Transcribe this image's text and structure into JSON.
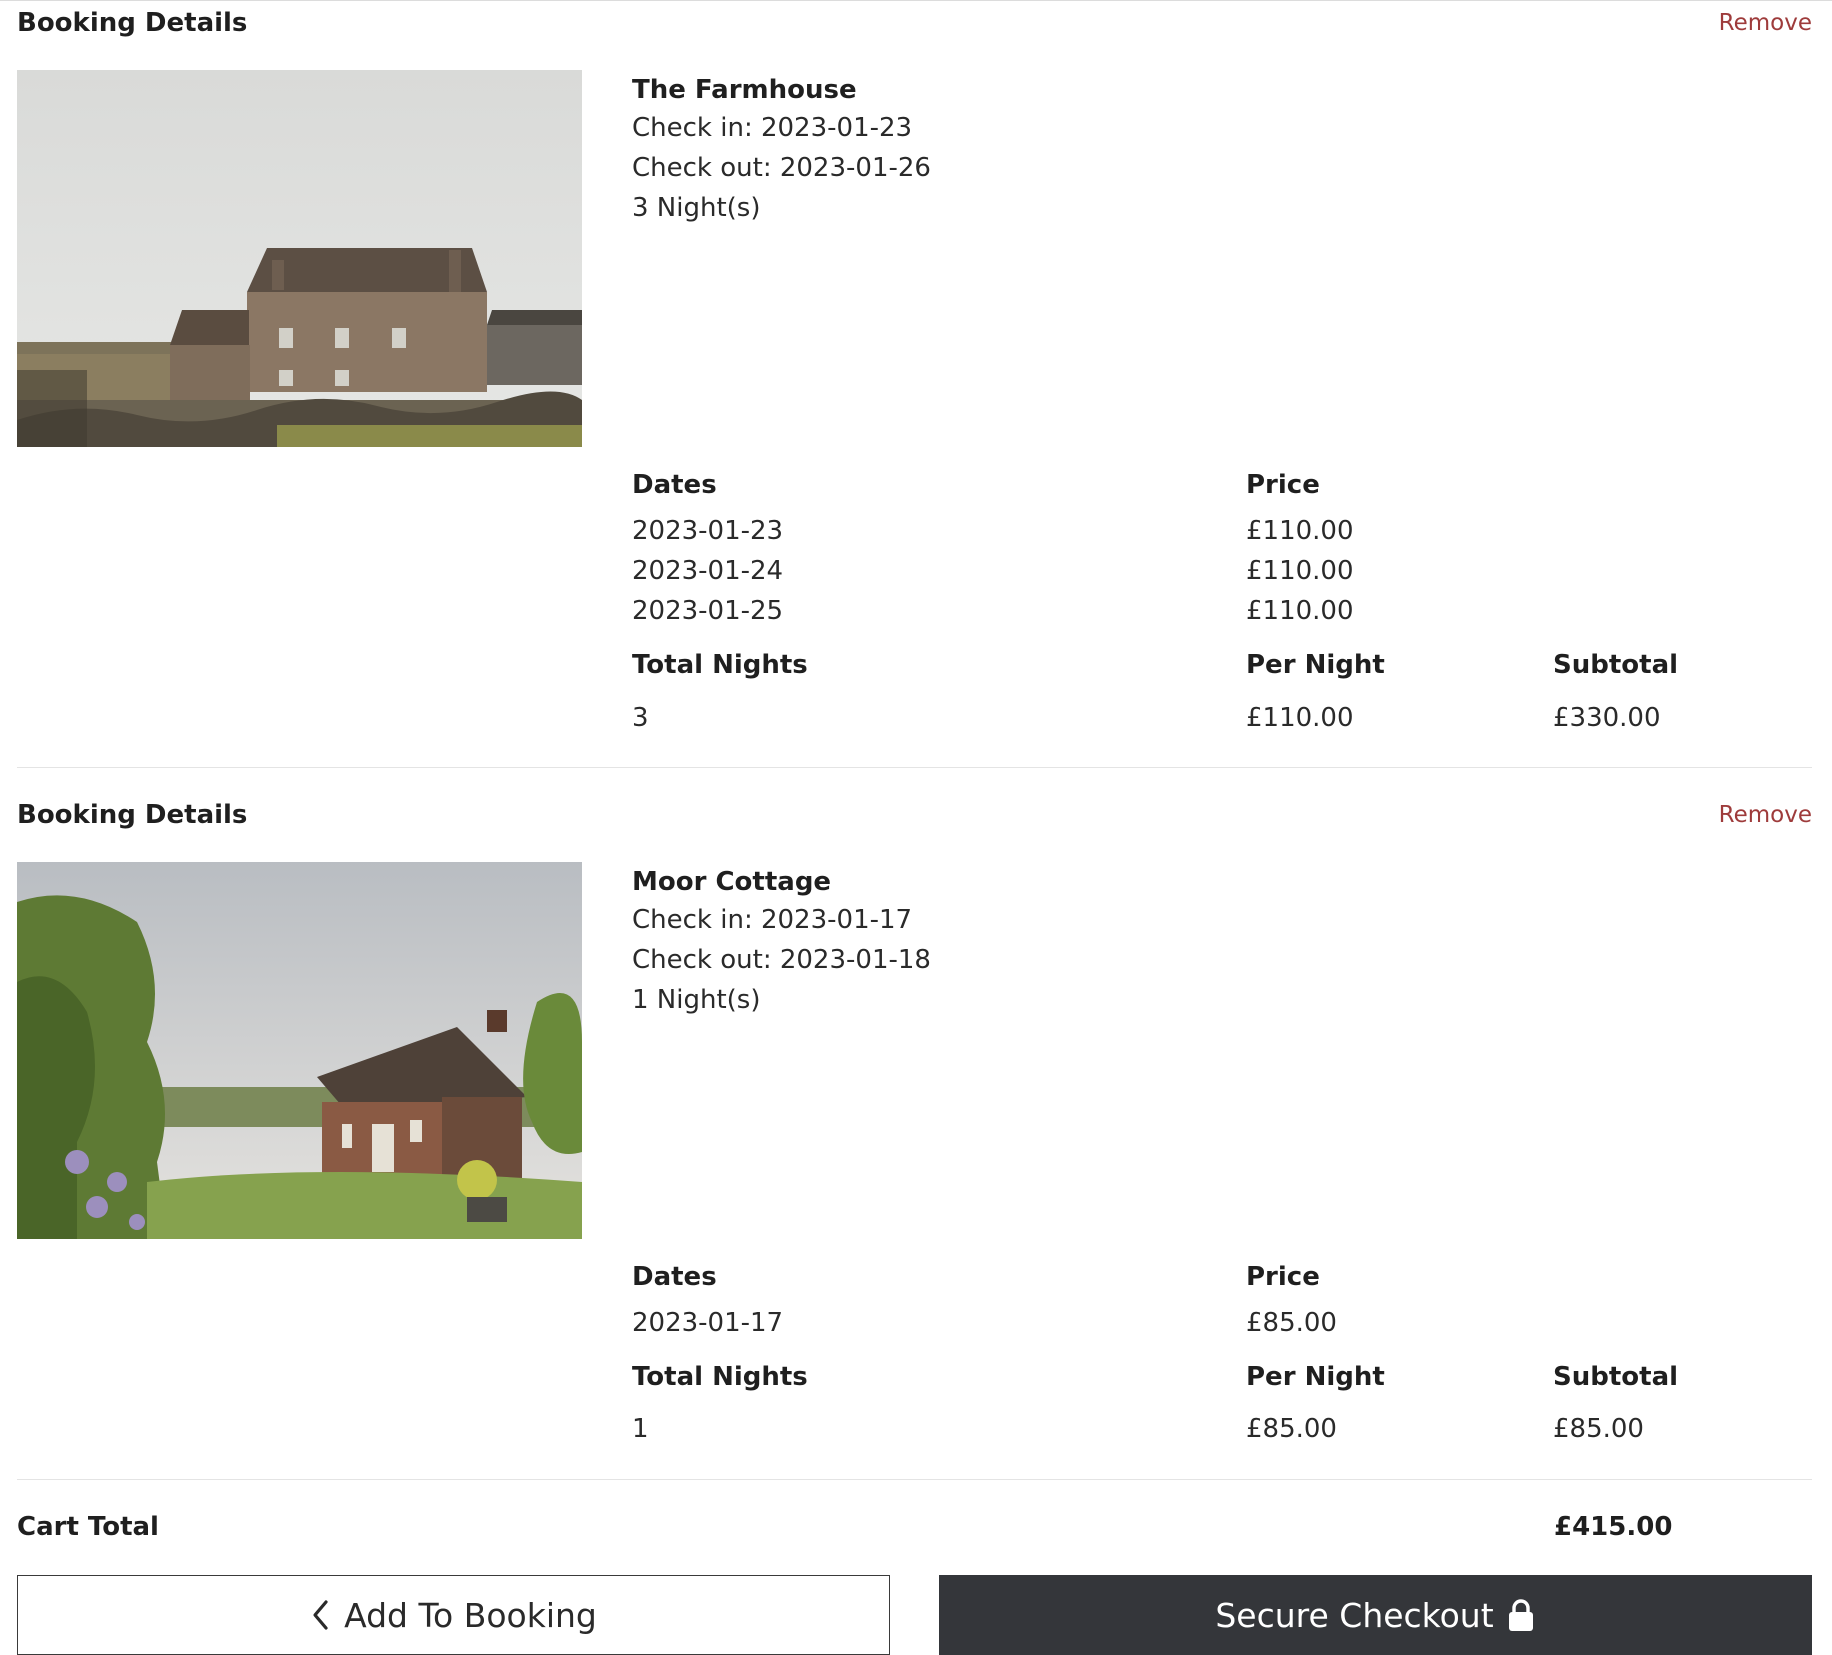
{
  "bookings": [
    {
      "section_title": "Booking Details",
      "remove_label": "Remove",
      "property_name": "The Farmhouse",
      "check_in": "Check in: 2023-01-23",
      "check_out": "Check out: 2023-01-26",
      "nights_text": "3 Night(s)",
      "dates_header": "Dates",
      "price_header": "Price",
      "rows": [
        {
          "date": "2023-01-23",
          "price": "£110.00"
        },
        {
          "date": "2023-01-24",
          "price": "£110.00"
        },
        {
          "date": "2023-01-25",
          "price": "£110.00"
        }
      ],
      "total_nights_header": "Total Nights",
      "per_night_header": "Per Night",
      "subtotal_header": "Subtotal",
      "total_nights": "3",
      "per_night": "£110.00",
      "subtotal": "£330.00"
    },
    {
      "section_title": "Booking Details",
      "remove_label": "Remove",
      "property_name": "Moor Cottage",
      "check_in": "Check in: 2023-01-17",
      "check_out": "Check out: 2023-01-18",
      "nights_text": "1 Night(s)",
      "dates_header": "Dates",
      "price_header": "Price",
      "rows": [
        {
          "date": "2023-01-17",
          "price": "£85.00"
        }
      ],
      "total_nights_header": "Total Nights",
      "per_night_header": "Per Night",
      "subtotal_header": "Subtotal",
      "total_nights": "1",
      "per_night": "£85.00",
      "subtotal": "£85.00"
    }
  ],
  "cart": {
    "total_label": "Cart Total",
    "total_value": "£415.00"
  },
  "actions": {
    "add_label": "Add To Booking",
    "add_icon": "chevron-left-icon",
    "checkout_label": "Secure Checkout",
    "checkout_icon": "lock-icon"
  },
  "colors": {
    "remove_link": "#9e3b3b",
    "checkout_bg": "#34363a"
  }
}
